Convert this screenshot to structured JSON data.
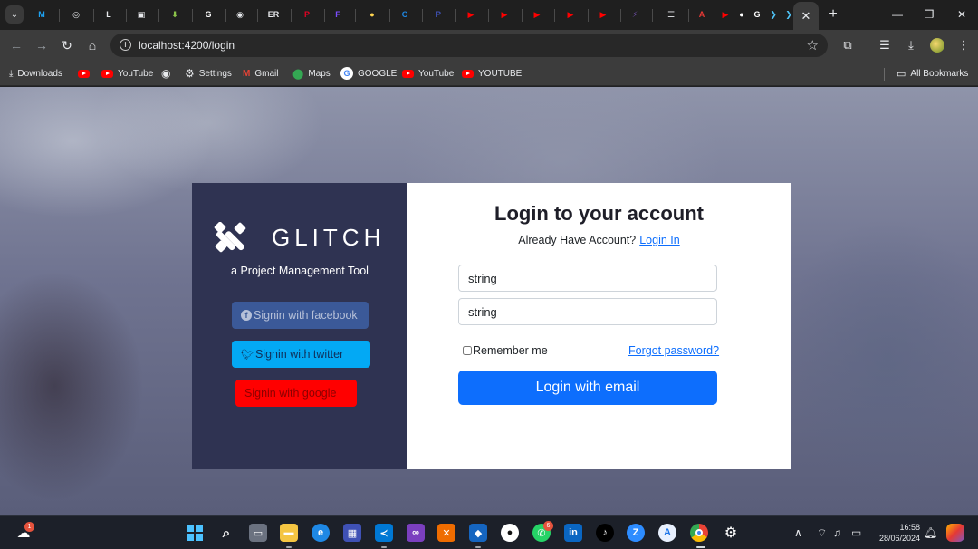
{
  "browser": {
    "active_tab_close": "✕",
    "new_tab": "+",
    "url": "localhost:4200/login"
  },
  "tabs": [
    {
      "icon": "m-logo-icon",
      "glyph": "M",
      "color": "#1da1f2"
    },
    {
      "icon": "globe-icon",
      "glyph": "◎",
      "color": "#e8eaed"
    },
    {
      "icon": "l-logo-icon",
      "glyph": "L",
      "color": "#e8eaed"
    },
    {
      "icon": "image-icon",
      "glyph": "▣",
      "color": "#e8eaed"
    },
    {
      "icon": "download-arrow-icon",
      "glyph": "⬇",
      "color": "#8bc34a"
    },
    {
      "icon": "google-icon",
      "glyph": "G",
      "color": "#ffffff"
    },
    {
      "icon": "world-icon",
      "glyph": "◉",
      "color": "#e8eaed"
    },
    {
      "icon": "er-logo-icon",
      "glyph": "ER",
      "color": "#e8eaed"
    },
    {
      "icon": "pinterest-icon",
      "glyph": "P",
      "color": "#e60023"
    },
    {
      "icon": "figma-icon",
      "glyph": "F",
      "color": "#7c4dff"
    },
    {
      "icon": "bulb-icon",
      "glyph": "●",
      "color": "#ffd54f"
    },
    {
      "icon": "c-logo-icon",
      "glyph": "C",
      "color": "#1e88e5"
    },
    {
      "icon": "p-logo-icon",
      "glyph": "P",
      "color": "#3f51b5"
    },
    {
      "icon": "youtube-icon",
      "glyph": "▶",
      "color": "#ff0000"
    },
    {
      "icon": "youtube-icon",
      "glyph": "▶",
      "color": "#ff0000"
    },
    {
      "icon": "youtube-icon",
      "glyph": "▶",
      "color": "#ff0000"
    },
    {
      "icon": "youtube-icon",
      "glyph": "▶",
      "color": "#ff0000"
    },
    {
      "icon": "youtube-icon",
      "glyph": "▶",
      "color": "#ff0000"
    },
    {
      "icon": "bolt-icon",
      "glyph": "⚡",
      "color": "#7e57c2"
    },
    {
      "icon": "menu-logo-icon",
      "glyph": "☰",
      "color": "#e8eaed"
    },
    {
      "icon": "angular-icon",
      "glyph": "A",
      "color": "#e53935"
    },
    {
      "icon": "youtube-icon",
      "glyph": "▶",
      "color": "#ff0000"
    },
    {
      "icon": "github-icon",
      "glyph": "●",
      "color": "#ffffff"
    },
    {
      "icon": "google-icon",
      "glyph": "G",
      "color": "#ffffff"
    },
    {
      "icon": "arrow-logo-icon",
      "glyph": "❯",
      "color": "#4fc3f7"
    },
    {
      "icon": "arrow-logo-icon",
      "glyph": "❯",
      "color": "#4fc3f7"
    }
  ],
  "bookmarks": [
    {
      "label": "Downloads",
      "icon": "download-icon"
    },
    {
      "label": "",
      "icon": "youtube-icon"
    },
    {
      "label": "YouTube",
      "icon": "youtube-icon"
    },
    {
      "label": "",
      "icon": "globe-icon"
    },
    {
      "label": "Settings",
      "icon": "gear-icon"
    },
    {
      "label": "Gmail",
      "icon": "gmail-icon"
    },
    {
      "label": "Maps",
      "icon": "maps-icon"
    },
    {
      "label": "GOOGLE",
      "icon": "google-icon"
    },
    {
      "label": "YouTube",
      "icon": "youtube-icon"
    },
    {
      "label": "YOUTUBE",
      "icon": "youtube-icon"
    }
  ],
  "all_bookmarks": "All Bookmarks",
  "login": {
    "brand": "GLITCH",
    "tagline": "a Project Management Tool",
    "facebook_label": "Signin with facebook",
    "twitter_label": "Signin with twitter",
    "google_label": "Signin with google",
    "title": "Login to your account",
    "have_account": "Already Have Account?",
    "login_in_link": "Login In",
    "username_value": "string",
    "password_value": "string",
    "remember_label": "Remember me",
    "forgot_label": "Forgot password?",
    "submit_label": "Login with email"
  },
  "taskbar": {
    "weather_badge": "1",
    "whatsapp_badge": "6",
    "time": "16:58",
    "date": "28/06/2024"
  }
}
